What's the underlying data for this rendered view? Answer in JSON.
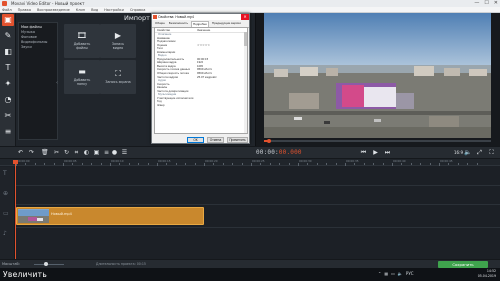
{
  "window": {
    "title": "Movavi Video Editor - Новый проект",
    "controls": [
      "—",
      "☐",
      "✕"
    ]
  },
  "menu": [
    "Файл",
    "Правка",
    "Воспроизведение",
    "Клип",
    "Вид",
    "Настройки",
    "Справка"
  ],
  "left_panel": {
    "title": "Импорт",
    "categories": [
      "Мои файлы",
      "Музыка",
      "Фоновое",
      "Видеофильмы",
      "Звуки"
    ],
    "tiles": [
      {
        "icon": "add-files-icon",
        "label": "Добавить\nфайлы"
      },
      {
        "icon": "record-video-icon",
        "label": "Запись\nвидео"
      },
      {
        "icon": "add-folder-icon",
        "label": "Добавить\nпапку"
      },
      {
        "icon": "screen-capture-icon",
        "label": "Запись экрана"
      }
    ]
  },
  "properties_dialog": {
    "title": "Свойства: Новый.mp4",
    "tabs": [
      "Общие",
      "Безопасность",
      "Подробно",
      "Предыдущие версии"
    ],
    "active_tab": "Подробно",
    "header": {
      "name": "Свойство",
      "value": "Значение"
    },
    "rows": [
      {
        "k": "Описание",
        "v": "",
        "section": true
      },
      {
        "k": "Название",
        "v": ""
      },
      {
        "k": "Подзаголовок",
        "v": ""
      },
      {
        "k": "Оценка",
        "v": "☆☆☆☆☆"
      },
      {
        "k": "Теги",
        "v": ""
      },
      {
        "k": "Комментарии",
        "v": ""
      },
      {
        "k": "Видео",
        "v": "",
        "section": true
      },
      {
        "k": "Продолжительность",
        "v": "00:00:15"
      },
      {
        "k": "Ширина кадра",
        "v": "1920"
      },
      {
        "k": "Высота кадра",
        "v": "1080"
      },
      {
        "k": "Скорость потока данных",
        "v": "9569 кбит/с"
      },
      {
        "k": "Общая скорость потока",
        "v": "9569 кбит/с"
      },
      {
        "k": "Частота кадров",
        "v": "25.07 кадров/с"
      },
      {
        "k": "Аудио",
        "v": "",
        "section": true
      },
      {
        "k": "Скорость",
        "v": ""
      },
      {
        "k": "Каналы",
        "v": ""
      },
      {
        "k": "Частота дискретизации",
        "v": ""
      },
      {
        "k": "Мультимедиа",
        "v": "",
        "section": true
      },
      {
        "k": "Участвующие исполнители",
        "v": ""
      },
      {
        "k": "Год",
        "v": ""
      },
      {
        "k": "Жанр",
        "v": ""
      }
    ],
    "buttons": {
      "ok": "ОК",
      "cancel": "Отмена",
      "apply": "Применить"
    }
  },
  "preview": {
    "timecode_main": "00:00:",
    "timecode_accent": "00.000",
    "progress": 0.02
  },
  "timeline": {
    "ruler_labels": [
      "00:00:00",
      "00:00:05",
      "00:00:10",
      "00:00:15",
      "00:00:20",
      "00:00:25",
      "00:00:30",
      "00:00:35",
      "00:00:40",
      "00:00:45"
    ],
    "clip_label": "Новый.mp4"
  },
  "footer": {
    "zoom_label": "Масштаб:",
    "duration": "Длительность проекта: 00:15",
    "save_label": "Сохранить"
  },
  "taskbar": {
    "overlay_text": "Увеличить",
    "time": "14:52",
    "date": "05.04.2019"
  },
  "colors": {
    "accent": "#e2522e",
    "save": "#3fa34d",
    "clip": "#c9882d"
  }
}
